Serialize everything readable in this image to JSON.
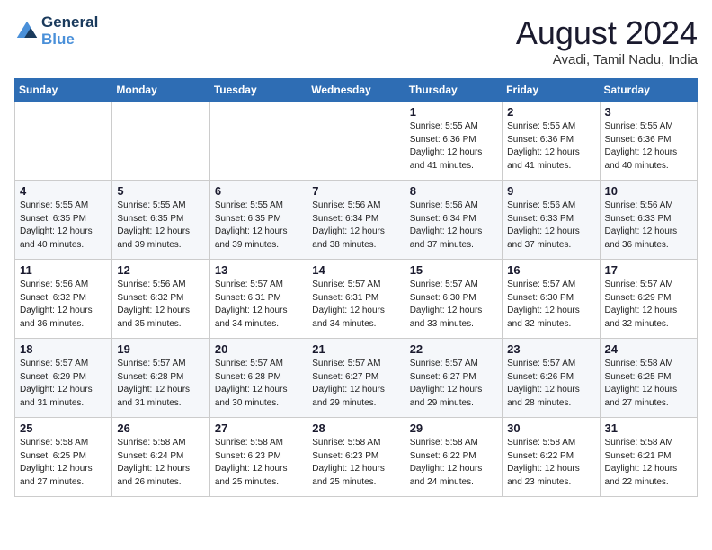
{
  "header": {
    "logo_line1": "General",
    "logo_line2": "Blue",
    "main_title": "August 2024",
    "subtitle": "Avadi, Tamil Nadu, India"
  },
  "calendar": {
    "weekdays": [
      "Sunday",
      "Monday",
      "Tuesday",
      "Wednesday",
      "Thursday",
      "Friday",
      "Saturday"
    ],
    "weeks": [
      [
        {
          "num": "",
          "info": ""
        },
        {
          "num": "",
          "info": ""
        },
        {
          "num": "",
          "info": ""
        },
        {
          "num": "",
          "info": ""
        },
        {
          "num": "1",
          "info": "Sunrise: 5:55 AM\nSunset: 6:36 PM\nDaylight: 12 hours\nand 41 minutes."
        },
        {
          "num": "2",
          "info": "Sunrise: 5:55 AM\nSunset: 6:36 PM\nDaylight: 12 hours\nand 41 minutes."
        },
        {
          "num": "3",
          "info": "Sunrise: 5:55 AM\nSunset: 6:36 PM\nDaylight: 12 hours\nand 40 minutes."
        }
      ],
      [
        {
          "num": "4",
          "info": "Sunrise: 5:55 AM\nSunset: 6:35 PM\nDaylight: 12 hours\nand 40 minutes."
        },
        {
          "num": "5",
          "info": "Sunrise: 5:55 AM\nSunset: 6:35 PM\nDaylight: 12 hours\nand 39 minutes."
        },
        {
          "num": "6",
          "info": "Sunrise: 5:55 AM\nSunset: 6:35 PM\nDaylight: 12 hours\nand 39 minutes."
        },
        {
          "num": "7",
          "info": "Sunrise: 5:56 AM\nSunset: 6:34 PM\nDaylight: 12 hours\nand 38 minutes."
        },
        {
          "num": "8",
          "info": "Sunrise: 5:56 AM\nSunset: 6:34 PM\nDaylight: 12 hours\nand 37 minutes."
        },
        {
          "num": "9",
          "info": "Sunrise: 5:56 AM\nSunset: 6:33 PM\nDaylight: 12 hours\nand 37 minutes."
        },
        {
          "num": "10",
          "info": "Sunrise: 5:56 AM\nSunset: 6:33 PM\nDaylight: 12 hours\nand 36 minutes."
        }
      ],
      [
        {
          "num": "11",
          "info": "Sunrise: 5:56 AM\nSunset: 6:32 PM\nDaylight: 12 hours\nand 36 minutes."
        },
        {
          "num": "12",
          "info": "Sunrise: 5:56 AM\nSunset: 6:32 PM\nDaylight: 12 hours\nand 35 minutes."
        },
        {
          "num": "13",
          "info": "Sunrise: 5:57 AM\nSunset: 6:31 PM\nDaylight: 12 hours\nand 34 minutes."
        },
        {
          "num": "14",
          "info": "Sunrise: 5:57 AM\nSunset: 6:31 PM\nDaylight: 12 hours\nand 34 minutes."
        },
        {
          "num": "15",
          "info": "Sunrise: 5:57 AM\nSunset: 6:30 PM\nDaylight: 12 hours\nand 33 minutes."
        },
        {
          "num": "16",
          "info": "Sunrise: 5:57 AM\nSunset: 6:30 PM\nDaylight: 12 hours\nand 32 minutes."
        },
        {
          "num": "17",
          "info": "Sunrise: 5:57 AM\nSunset: 6:29 PM\nDaylight: 12 hours\nand 32 minutes."
        }
      ],
      [
        {
          "num": "18",
          "info": "Sunrise: 5:57 AM\nSunset: 6:29 PM\nDaylight: 12 hours\nand 31 minutes."
        },
        {
          "num": "19",
          "info": "Sunrise: 5:57 AM\nSunset: 6:28 PM\nDaylight: 12 hours\nand 31 minutes."
        },
        {
          "num": "20",
          "info": "Sunrise: 5:57 AM\nSunset: 6:28 PM\nDaylight: 12 hours\nand 30 minutes."
        },
        {
          "num": "21",
          "info": "Sunrise: 5:57 AM\nSunset: 6:27 PM\nDaylight: 12 hours\nand 29 minutes."
        },
        {
          "num": "22",
          "info": "Sunrise: 5:57 AM\nSunset: 6:27 PM\nDaylight: 12 hours\nand 29 minutes."
        },
        {
          "num": "23",
          "info": "Sunrise: 5:57 AM\nSunset: 6:26 PM\nDaylight: 12 hours\nand 28 minutes."
        },
        {
          "num": "24",
          "info": "Sunrise: 5:58 AM\nSunset: 6:25 PM\nDaylight: 12 hours\nand 27 minutes."
        }
      ],
      [
        {
          "num": "25",
          "info": "Sunrise: 5:58 AM\nSunset: 6:25 PM\nDaylight: 12 hours\nand 27 minutes."
        },
        {
          "num": "26",
          "info": "Sunrise: 5:58 AM\nSunset: 6:24 PM\nDaylight: 12 hours\nand 26 minutes."
        },
        {
          "num": "27",
          "info": "Sunrise: 5:58 AM\nSunset: 6:23 PM\nDaylight: 12 hours\nand 25 minutes."
        },
        {
          "num": "28",
          "info": "Sunrise: 5:58 AM\nSunset: 6:23 PM\nDaylight: 12 hours\nand 25 minutes."
        },
        {
          "num": "29",
          "info": "Sunrise: 5:58 AM\nSunset: 6:22 PM\nDaylight: 12 hours\nand 24 minutes."
        },
        {
          "num": "30",
          "info": "Sunrise: 5:58 AM\nSunset: 6:22 PM\nDaylight: 12 hours\nand 23 minutes."
        },
        {
          "num": "31",
          "info": "Sunrise: 5:58 AM\nSunset: 6:21 PM\nDaylight: 12 hours\nand 22 minutes."
        }
      ]
    ]
  }
}
